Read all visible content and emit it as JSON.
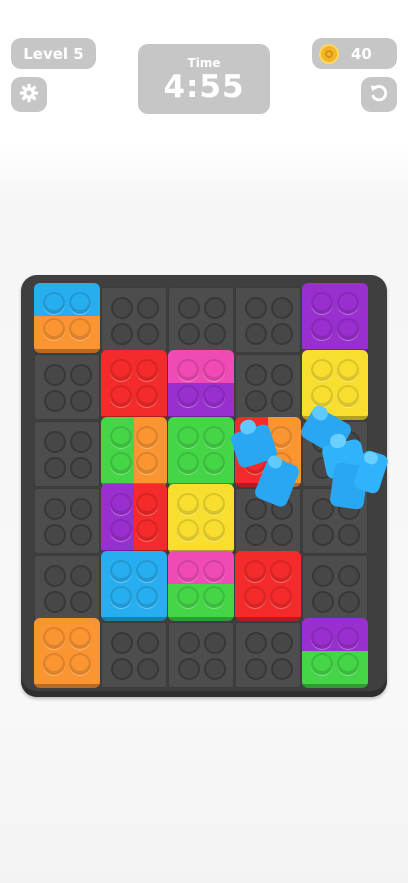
{
  "hud": {
    "level_label": "Level 5",
    "time_label": "Time",
    "time_value": "4:55",
    "coins": "40"
  },
  "icons": {
    "settings": "gear-icon",
    "undo": "undo-icon",
    "coin": "coin-icon"
  },
  "colors": {
    "blue": "#27aef0",
    "orange": "#fb9532",
    "red": "#f52a2a",
    "pink": "#f04bb5",
    "purple": "#9a2fd0",
    "yellow": "#f8df2f",
    "green": "#44d647"
  },
  "board": {
    "cols": 5,
    "rows": 6,
    "bricks": [
      {
        "col": 0,
        "row": 0,
        "type": "h",
        "top": "blue",
        "bottom": "orange"
      },
      {
        "col": 4,
        "row": 0,
        "type": "solid",
        "color": "purple"
      },
      {
        "col": 1,
        "row": 1,
        "type": "solid",
        "color": "red"
      },
      {
        "col": 2,
        "row": 1,
        "type": "h",
        "top": "pink",
        "bottom": "purple"
      },
      {
        "col": 4,
        "row": 1,
        "type": "solid",
        "color": "yellow"
      },
      {
        "col": 1,
        "row": 2,
        "type": "v",
        "left": "green",
        "right": "orange"
      },
      {
        "col": 2,
        "row": 2,
        "type": "solid",
        "color": "green"
      },
      {
        "col": 3,
        "row": 2,
        "type": "v",
        "left": "red",
        "right": "orange"
      },
      {
        "col": 1,
        "row": 3,
        "type": "v",
        "left": "purple",
        "right": "red"
      },
      {
        "col": 2,
        "row": 3,
        "type": "solid",
        "color": "yellow"
      },
      {
        "col": 1,
        "row": 4,
        "type": "solid",
        "color": "blue"
      },
      {
        "col": 2,
        "row": 4,
        "type": "h",
        "top": "pink",
        "bottom": "green"
      },
      {
        "col": 3,
        "row": 4,
        "type": "solid",
        "color": "red"
      },
      {
        "col": 0,
        "row": 5,
        "type": "solid",
        "color": "orange"
      },
      {
        "col": 4,
        "row": 5,
        "type": "h",
        "top": "purple",
        "bottom": "green"
      }
    ]
  }
}
